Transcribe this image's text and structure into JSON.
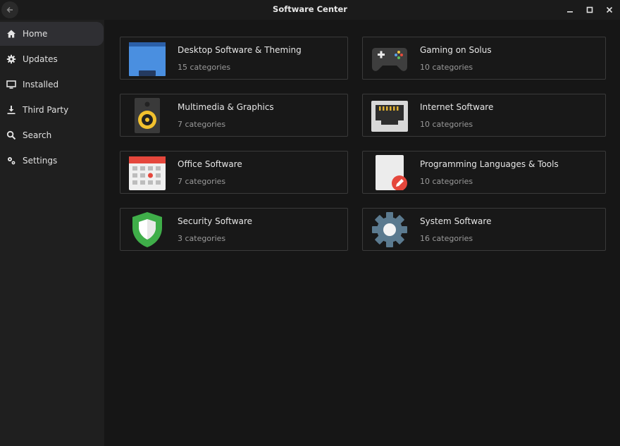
{
  "window": {
    "title": "Software Center"
  },
  "sidebar": {
    "items": [
      {
        "label": "Home",
        "icon": "home-icon",
        "active": true
      },
      {
        "label": "Updates",
        "icon": "gear-icon"
      },
      {
        "label": "Installed",
        "icon": "monitor-icon"
      },
      {
        "label": "Third Party",
        "icon": "download-icon"
      },
      {
        "label": "Search",
        "icon": "search-icon"
      },
      {
        "label": "Settings",
        "icon": "settings-icon"
      }
    ]
  },
  "categories": [
    {
      "title": "Desktop Software & Theming",
      "subtitle": "15 categories",
      "icon": "desktop-icon"
    },
    {
      "title": "Gaming on Solus",
      "subtitle": "10 categories",
      "icon": "gamepad-icon"
    },
    {
      "title": "Multimedia & Graphics",
      "subtitle": "7 categories",
      "icon": "speaker-icon"
    },
    {
      "title": "Internet Software",
      "subtitle": "10 categories",
      "icon": "network-port-icon"
    },
    {
      "title": "Office Software",
      "subtitle": "7 categories",
      "icon": "calendar-icon"
    },
    {
      "title": "Programming Languages & Tools",
      "subtitle": "10 categories",
      "icon": "document-edit-icon"
    },
    {
      "title": "Security Software",
      "subtitle": "3 categories",
      "icon": "shield-icon"
    },
    {
      "title": "System Software",
      "subtitle": "16 categories",
      "icon": "system-gear-icon"
    }
  ],
  "colors": {
    "background": "#161616",
    "sidebar": "#1f1f1f",
    "active_item": "#2f2f33",
    "card_border": "#3a3a3a"
  }
}
